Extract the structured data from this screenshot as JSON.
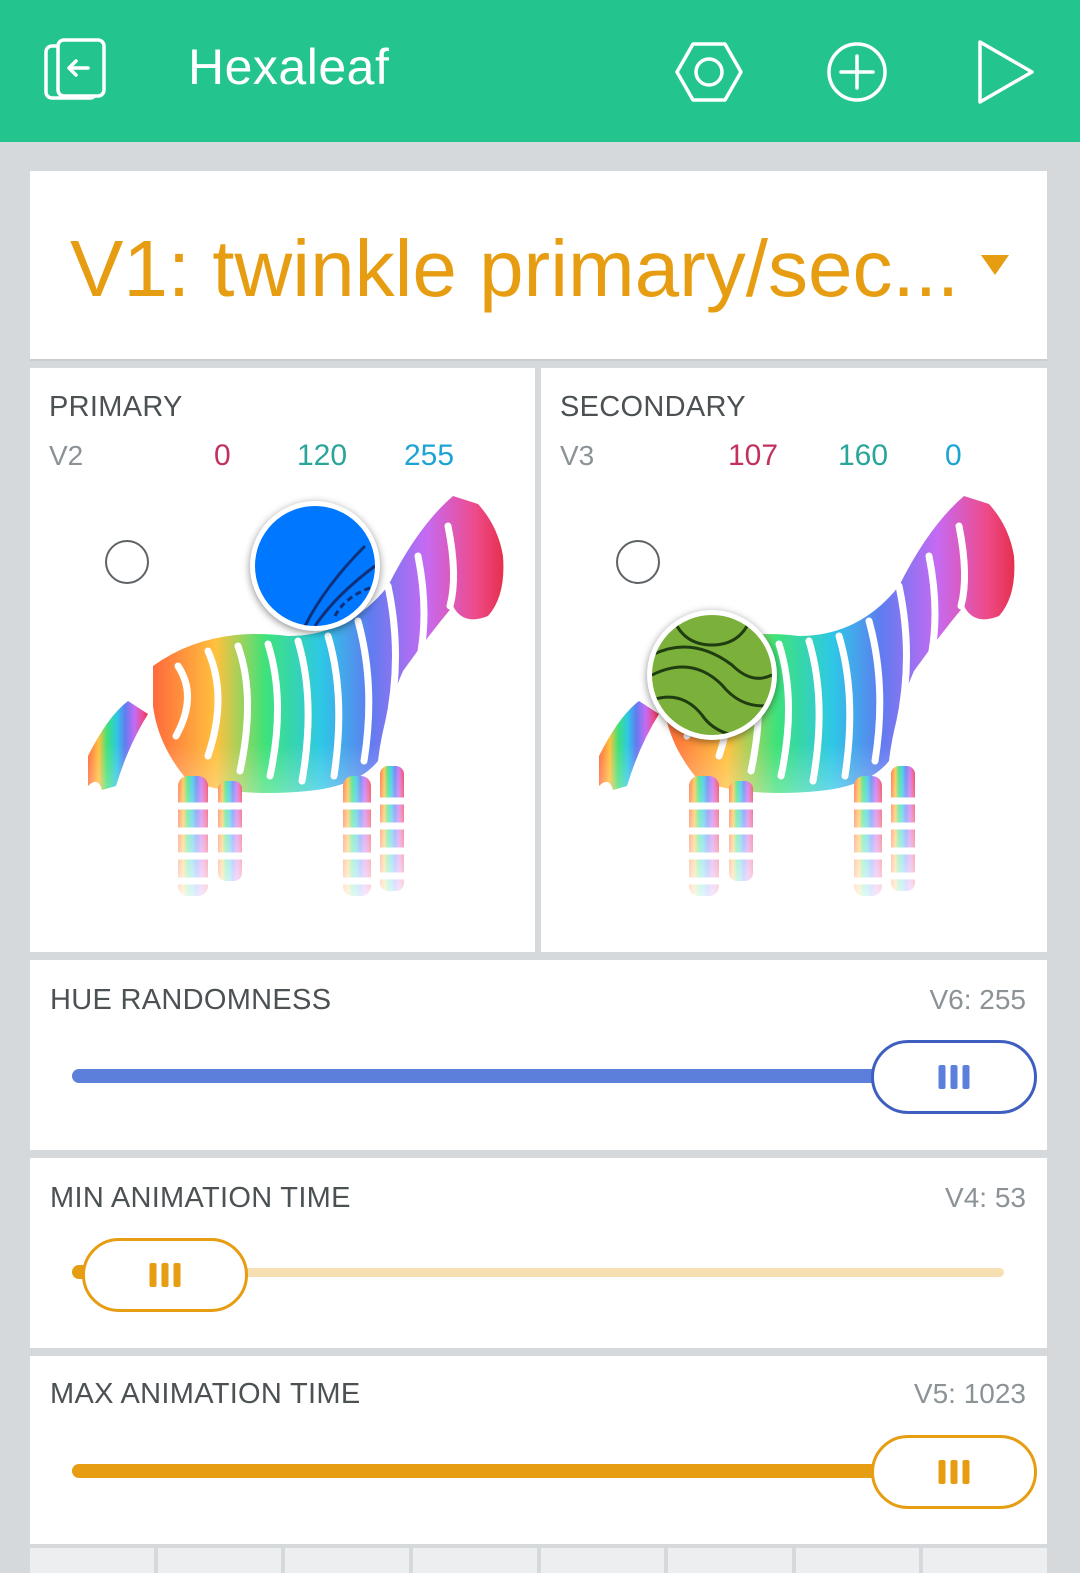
{
  "header": {
    "title": "Hexaleaf",
    "bg_color": "#23c48e",
    "icons": [
      "exit-project-icon",
      "settings-hexagon-icon",
      "add-widget-icon",
      "play-icon"
    ]
  },
  "menu": {
    "value": "V1: twinkle primary/sec...",
    "color": "#e79d11"
  },
  "primary": {
    "label": "PRIMARY",
    "pin": "V2",
    "r": "0",
    "g": "120",
    "b": "255",
    "color": "#0077ff"
  },
  "secondary": {
    "label": "SECONDARY",
    "pin": "V3",
    "r": "107",
    "g": "160",
    "b": "0",
    "color": "#6ba000"
  },
  "sliders": {
    "hue": {
      "label": "HUE RANDOMNESS",
      "pin_value": "V6: 255",
      "level": 1.0,
      "color": "#5b7fdb"
    },
    "min_time": {
      "label": "MIN ANIMATION TIME",
      "pin_value": "V4: 53",
      "level": 0.05,
      "color": "#e79d11"
    },
    "max_time": {
      "label": "MAX ANIMATION TIME",
      "pin_value": "V5: 1023",
      "level": 1.0,
      "color": "#e79d11"
    }
  }
}
